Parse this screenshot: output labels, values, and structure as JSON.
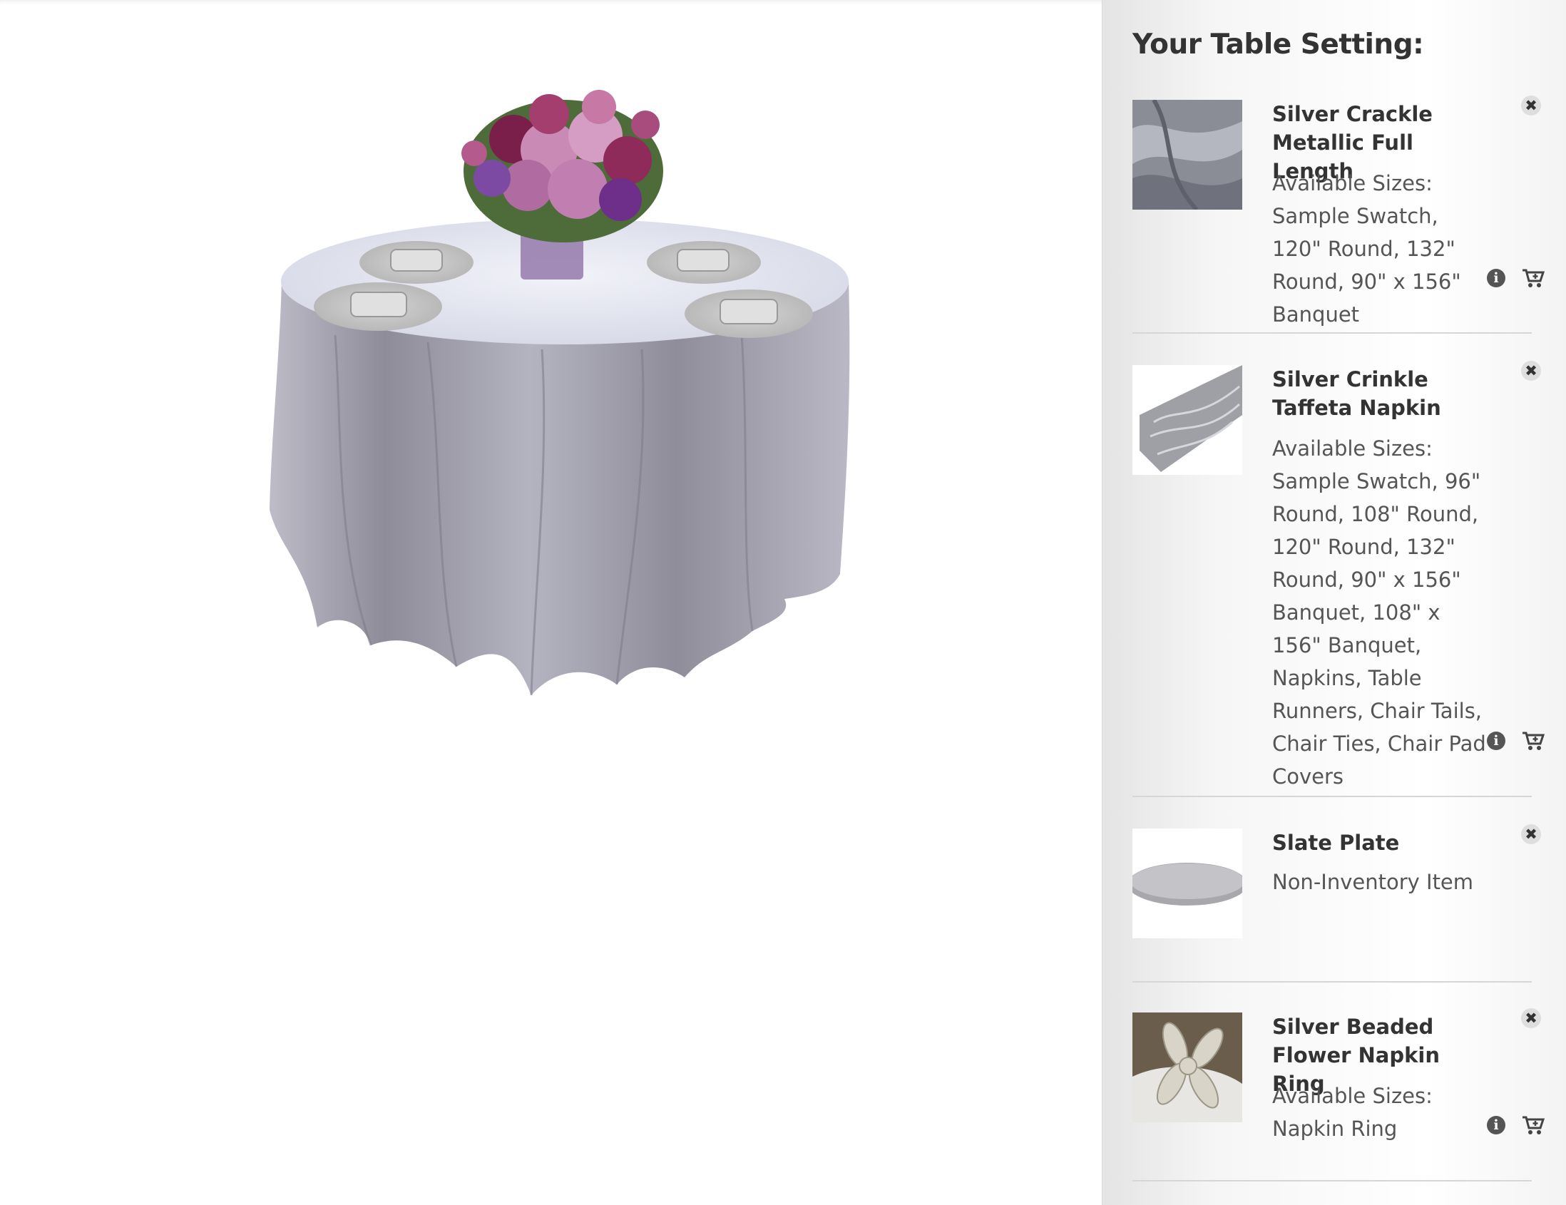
{
  "sidebar": {
    "title": "Your Table Setting:",
    "items": [
      {
        "name": "Silver Crackle Metallic Full Length",
        "desc": "Available Sizes: Sample Swatch, 120\" Round, 132\" Round, 90\" x 156\" Banquet",
        "thumb_icon": "tablecloth-swatch-image"
      },
      {
        "name": "Silver Crinkle Taffeta Napkin",
        "desc": "Available Sizes: Sample Swatch, 96\" Round, 108\" Round, 120\" Round, 132\" Round, 90\" x 156\" Banquet, 108\" x 156\" Banquet, Napkins, Table Runners, Chair Tails, Chair Ties, Chair Pad Covers",
        "thumb_icon": "napkin-image"
      },
      {
        "name": "Slate Plate",
        "desc": "Non-Inventory Item",
        "thumb_icon": "plate-image"
      },
      {
        "name": "Silver Beaded Flower Napkin Ring",
        "desc": "Available Sizes: Napkin Ring",
        "thumb_icon": "napkin-ring-image"
      }
    ],
    "remove_glyph": "✖",
    "info_glyph": "i",
    "icons": {
      "remove": "close-icon",
      "info": "info-icon",
      "cart": "cart-add-icon"
    }
  },
  "scene": {
    "description_icon": "table-setting-preview",
    "colors": {
      "tablecloth": "#9c9aa8",
      "tablecloth_top": "#e6e8f2",
      "plate": "#c8c8c8",
      "flowers": "#a0457a"
    }
  }
}
